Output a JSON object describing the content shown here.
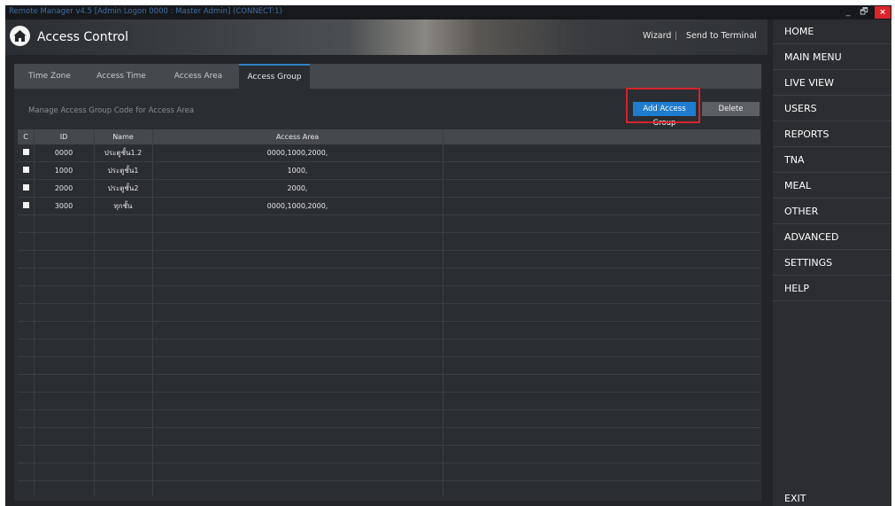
{
  "window": {
    "title": "Remote Manager v4.5 [Admin Logon 0000 : Master Admin] (CONNECT:1)",
    "minimize": "_",
    "restore": "🗗",
    "close": "×"
  },
  "header": {
    "title": "Access Control",
    "wizard": "Wizard",
    "separator": "|",
    "send_to_terminal": "Send to Terminal"
  },
  "tabs": [
    {
      "label": "Time Zone",
      "active": false
    },
    {
      "label": "Access Time",
      "active": false
    },
    {
      "label": "Access Area",
      "active": false
    },
    {
      "label": "Access Group",
      "active": true
    }
  ],
  "panel": {
    "description": "Manage Access Group Code for Access Area",
    "add_button": "Add Access Group",
    "delete_button": "Delete"
  },
  "table": {
    "columns": [
      "C",
      "ID",
      "Name",
      "Access Area"
    ],
    "rows": [
      {
        "id": "0000",
        "name": "ประตูชั้น1.2",
        "area": "0000,1000,2000,"
      },
      {
        "id": "1000",
        "name": "ประตูชั้น1",
        "area": "1000,"
      },
      {
        "id": "2000",
        "name": "ประตูชั้น2",
        "area": "2000,"
      },
      {
        "id": "3000",
        "name": "ทุกชั้น",
        "area": "0000,1000,2000,"
      }
    ]
  },
  "nav": {
    "items": [
      "HOME",
      "MAIN MENU",
      "LIVE VIEW",
      "USERS",
      "REPORTS",
      "TNA",
      "MEAL",
      "OTHER",
      "ADVANCED",
      "SETTINGS",
      "HELP"
    ],
    "exit": "EXIT"
  },
  "colors": {
    "accent": "#1f7ccf",
    "highlight": "#d6232e",
    "background": "#222428"
  }
}
